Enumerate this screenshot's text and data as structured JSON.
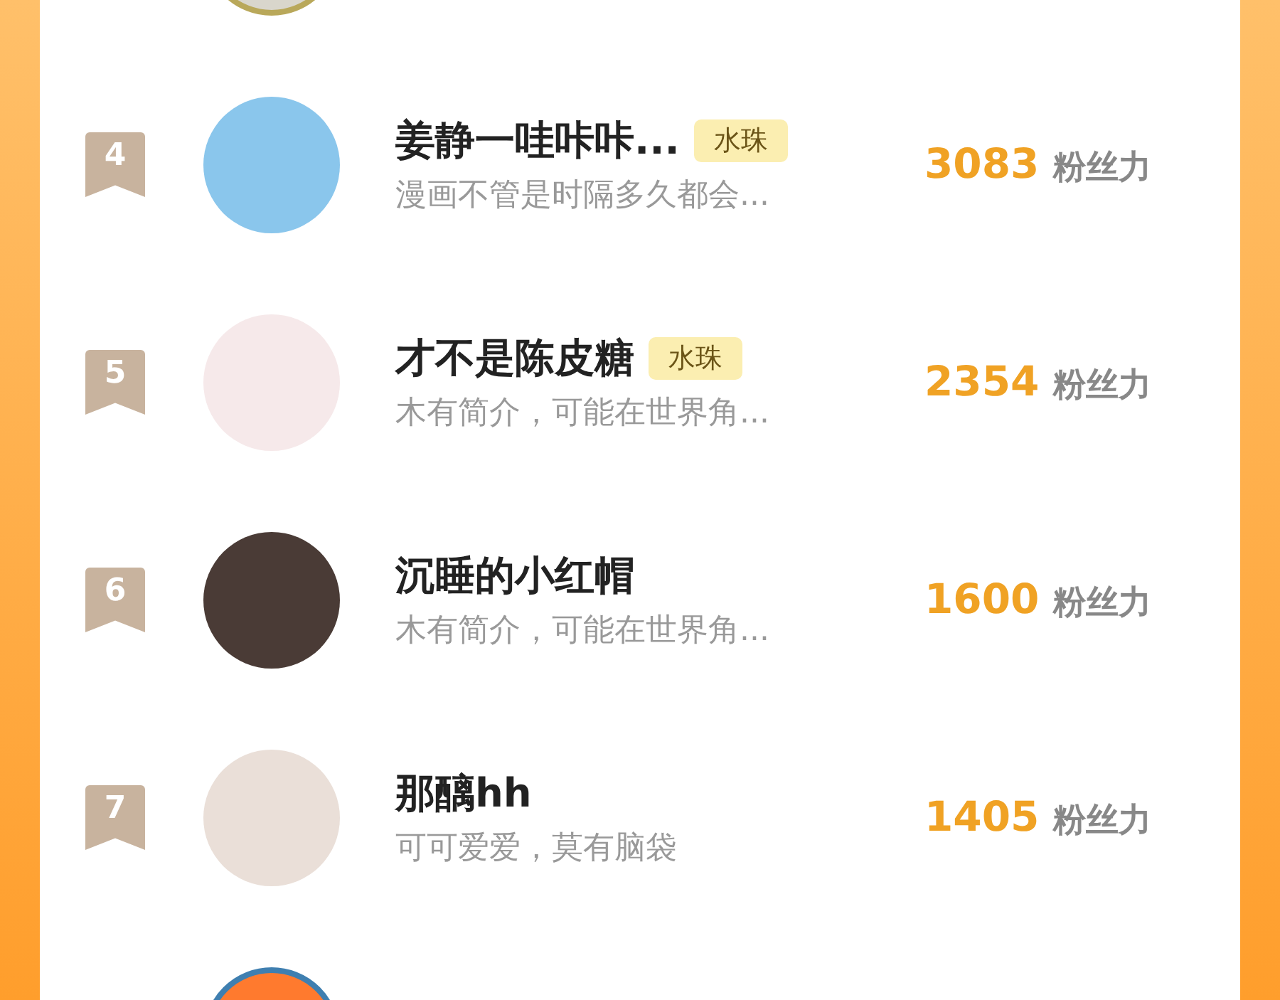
{
  "top_partial_row": {
    "avatar": true
  },
  "rows": [
    {
      "rank": "4",
      "name": "姜静一哇咔咔...",
      "tag": "水珠",
      "bio": "漫画不管是时隔多久都会...",
      "score": "3083",
      "score_unit": "粉丝力"
    },
    {
      "rank": "5",
      "name": "才不是陈皮糖",
      "tag": "水珠",
      "bio": "木有简介，可能在世界角...",
      "score": "2354",
      "score_unit": "粉丝力"
    },
    {
      "rank": "6",
      "name": "沉睡的小红帽",
      "bio": "木有简介，可能在世界角...",
      "score": "1600",
      "score_unit": "粉丝力"
    },
    {
      "rank": "7",
      "name": "那醨hh",
      "bio": "可可爱爱，莫有脑袋",
      "score": "1405",
      "score_unit": "粉丝力"
    }
  ],
  "bottom_partial_row": {
    "avatar": true
  }
}
